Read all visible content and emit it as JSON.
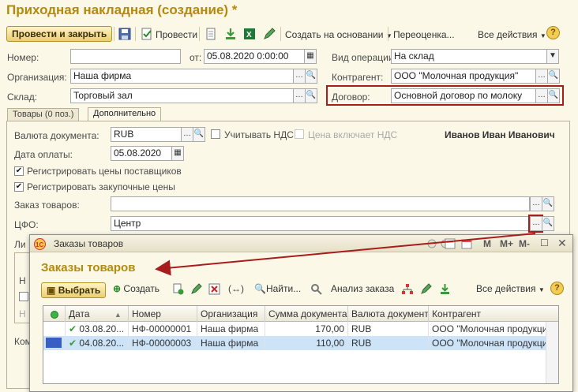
{
  "main": {
    "title": "Приходная накладная (создание) *",
    "toolbar": {
      "post_close": "Провести и закрыть",
      "post": "Провести",
      "create_based": "Создать на основании",
      "revaluation": "Переоценка...",
      "all_actions": "Все действия",
      "help": "?"
    },
    "fields": {
      "number_label": "Номер:",
      "number_value": "",
      "date_label": "от:",
      "date_value": "05.08.2020  0:00:00",
      "operation_label": "Вид операции:",
      "operation_value": "На склад",
      "org_label": "Организация:",
      "org_value": "Наша фирма",
      "contractor_label": "Контрагент:",
      "contractor_value": "ООО \"Молочная продукция\"",
      "warehouse_label": "Склад:",
      "warehouse_value": "Торговый зал",
      "contract_label": "Договор:",
      "contract_value": "Основной договор по молоку"
    },
    "tabs": [
      {
        "label": "Товары (0 поз.)"
      },
      {
        "label": "Дополнительно"
      }
    ],
    "extra": {
      "currency_label": "Валюта документа:",
      "currency_value": "RUB",
      "vat_label": "Учитывать НДС",
      "price_vat_label": "Цена включает НДС",
      "responsible": "Иванов Иван Иванович",
      "pay_date_label": "Дата оплаты:",
      "pay_date_value": "05.08.2020",
      "reg_supplier_label": "Регистрировать цены поставщиков",
      "reg_purchase_label": "Регистрировать закупочные цены",
      "order_label": "Заказ товаров:",
      "order_value": "",
      "cfo_label": "ЦФО:",
      "cfo_value": "Центр",
      "cut_label_1": "Ли",
      "cut_label_2": "Н",
      "cut_label_3": "Н",
      "cut_label_4": "Ком"
    }
  },
  "popup": {
    "window_title": "Заказы товаров",
    "header_title": "Заказы товаров",
    "wincontrols": [
      "M",
      "M+",
      "M-"
    ],
    "toolbar": {
      "select": "Выбрать",
      "create": "Создать",
      "find": "Найти...",
      "analysis": "Анализ заказа",
      "all_actions": "Все действия"
    },
    "columns": [
      "Дата",
      "Номер",
      "Организация",
      "Сумма документа",
      "Валюта документа",
      "Контрагент"
    ],
    "rows": [
      {
        "date": "03.08.20...",
        "number": "НФ-00000001",
        "org": "Наша фирма",
        "sum": "170,00",
        "currency": "RUB",
        "contractor": "ООО \"Молочная продукция\""
      },
      {
        "date": "04.08.20...",
        "number": "НФ-00000003",
        "org": "Наша фирма",
        "sum": "110,00",
        "currency": "RUB",
        "contractor": "ООО \"Молочная продукция\""
      }
    ]
  },
  "colors": {
    "accent_title": "#b48a0c",
    "highlight_red": "#a81c1c",
    "selected_row": "#cde3f8"
  }
}
